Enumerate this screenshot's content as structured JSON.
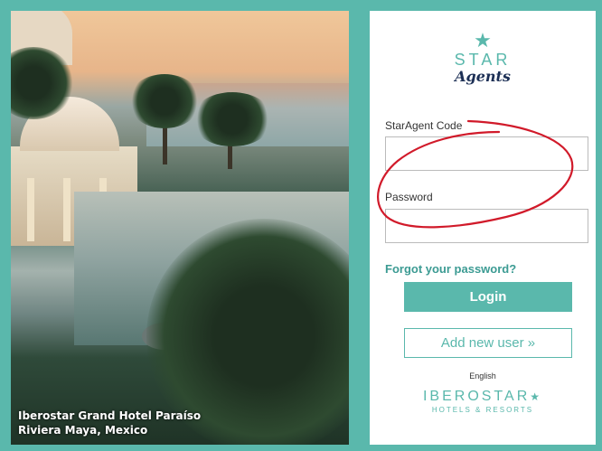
{
  "photo": {
    "caption_line1": "Iberostar Grand Hotel Paraíso",
    "caption_line2": "Riviera Maya, Mexico"
  },
  "brand": {
    "star_symbol": "★",
    "word1": "STAR",
    "word2": "Agents"
  },
  "form": {
    "code_label": "StarAgent Code",
    "code_value": "",
    "password_label": "Password",
    "password_value": "",
    "forgot_link": "Forgot your password?",
    "login_button": "Login",
    "add_user_button": "Add new user »",
    "language": "English"
  },
  "footer": {
    "logo_name": "IBEROSTAR",
    "logo_star": "★",
    "logo_subtitle": "HOTELS & RESORTS"
  },
  "colors": {
    "accent": "#5ab8ac",
    "annotation": "#d11a2a"
  }
}
